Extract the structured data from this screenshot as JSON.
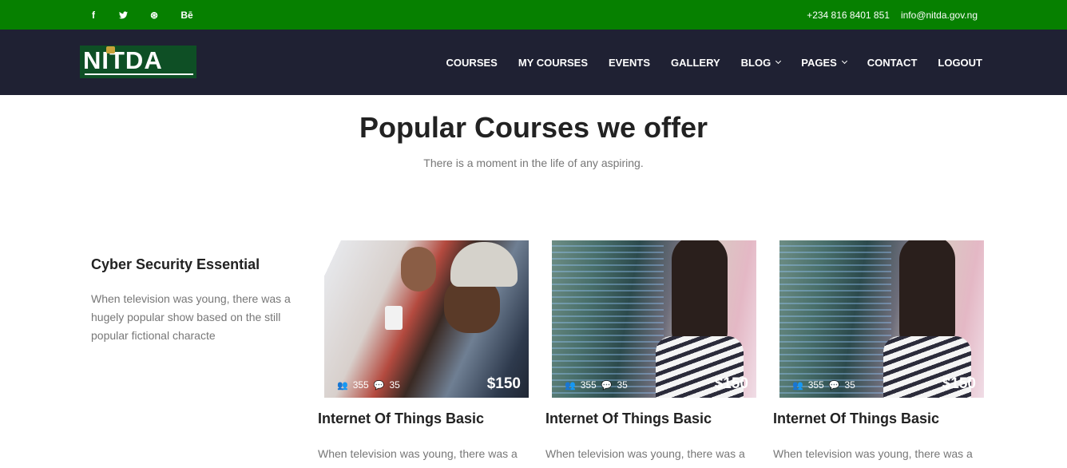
{
  "topbar": {
    "social": [
      {
        "icon": "facebook-icon",
        "glyph": "f"
      },
      {
        "icon": "twitter-icon",
        "glyph": "🐦"
      },
      {
        "icon": "dribbble-icon",
        "glyph": "⊛"
      },
      {
        "icon": "behance-icon",
        "glyph": "Bē"
      }
    ],
    "phone": "+234 816 8401 851",
    "email": "info@nitda.gov.ng"
  },
  "brand": {
    "logo_text": "NITDA"
  },
  "nav": [
    {
      "label": "COURSES"
    },
    {
      "label": "MY COURSES"
    },
    {
      "label": "EVENTS"
    },
    {
      "label": "GALLERY"
    },
    {
      "label": "BLOG"
    },
    {
      "label": "PAGES"
    },
    {
      "label": "CONTACT"
    },
    {
      "label": "LOGOUT"
    }
  ],
  "section": {
    "title": "Popular Courses we offer",
    "subtitle": "There is a moment in the life of any aspiring."
  },
  "intro": {
    "title": "Cyber Security Essential",
    "text": "When television was young, there was a hugely popular show based on the still popular fictional characte"
  },
  "courses": [
    {
      "students": "355",
      "comments": "35",
      "price": "$150",
      "title": "Internet Of Things Basic",
      "text": "When television was young, there was a hugely popular show based on the still"
    },
    {
      "students": "355",
      "comments": "35",
      "price": "$150",
      "title": "Internet Of Things Basic",
      "text": "When television was young, there was a hugely popular show based on the still"
    },
    {
      "students": "355",
      "comments": "35",
      "price": "$150",
      "title": "Internet Of Things Basic",
      "text": "When television was young, there was a hugely popular show based on the still"
    }
  ],
  "colors": {
    "topbar": "#068000",
    "navbar": "#1f2133"
  }
}
